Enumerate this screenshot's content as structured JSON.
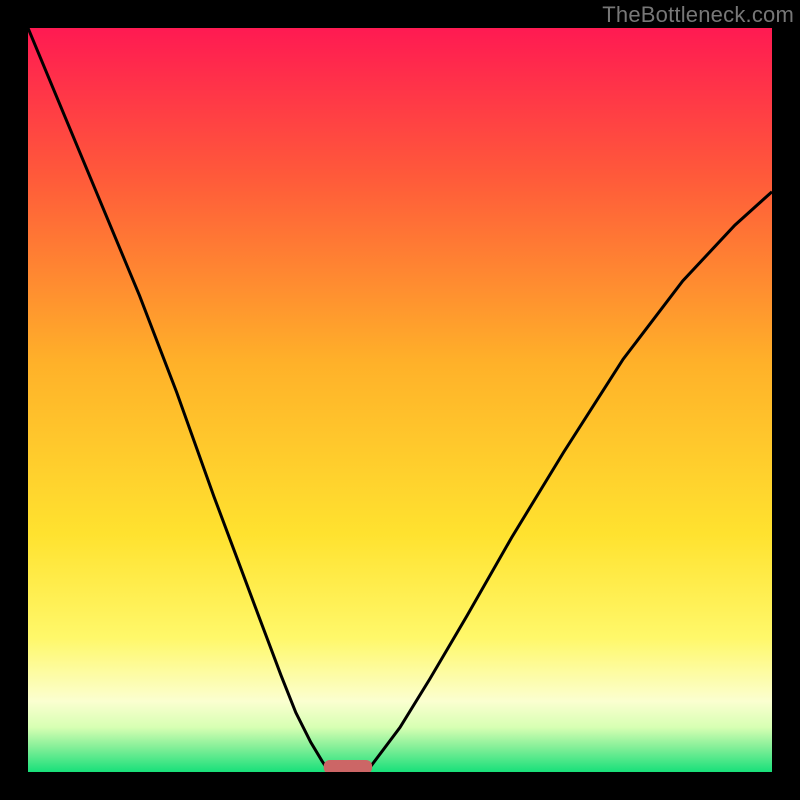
{
  "watermark": "TheBottleneck.com",
  "chart_data": {
    "type": "line",
    "title": "",
    "xlabel": "",
    "ylabel": "",
    "xlim": [
      0,
      1
    ],
    "ylim": [
      0,
      1
    ],
    "notes": "No numeric axis ticks or labels are visible. Curve values are estimated from the image as fractions of plot width/height.",
    "background_gradient": [
      {
        "stop": 0.0,
        "color": "#ff1a52"
      },
      {
        "stop": 0.2,
        "color": "#ff5a3a"
      },
      {
        "stop": 0.45,
        "color": "#ffb129"
      },
      {
        "stop": 0.68,
        "color": "#ffe22f"
      },
      {
        "stop": 0.82,
        "color": "#fff86a"
      },
      {
        "stop": 0.905,
        "color": "#fbffd0"
      },
      {
        "stop": 0.94,
        "color": "#d7ffb3"
      },
      {
        "stop": 0.965,
        "color": "#8af09a"
      },
      {
        "stop": 1.0,
        "color": "#18e07a"
      }
    ],
    "series": [
      {
        "name": "left-branch",
        "x": [
          0.0,
          0.05,
          0.1,
          0.15,
          0.2,
          0.25,
          0.28,
          0.31,
          0.34,
          0.36,
          0.38,
          0.395,
          0.405
        ],
        "y": [
          1.0,
          0.88,
          0.76,
          0.64,
          0.51,
          0.37,
          0.29,
          0.21,
          0.13,
          0.08,
          0.04,
          0.015,
          0.0
        ]
      },
      {
        "name": "right-branch",
        "x": [
          0.455,
          0.47,
          0.5,
          0.54,
          0.59,
          0.65,
          0.72,
          0.8,
          0.88,
          0.95,
          1.0
        ],
        "y": [
          0.0,
          0.02,
          0.06,
          0.125,
          0.21,
          0.315,
          0.43,
          0.555,
          0.66,
          0.735,
          0.78
        ]
      }
    ],
    "marker": {
      "name": "bottom-marker",
      "x_center": 0.43,
      "width": 0.065,
      "y": 0.0,
      "color": "#cc6666"
    }
  }
}
